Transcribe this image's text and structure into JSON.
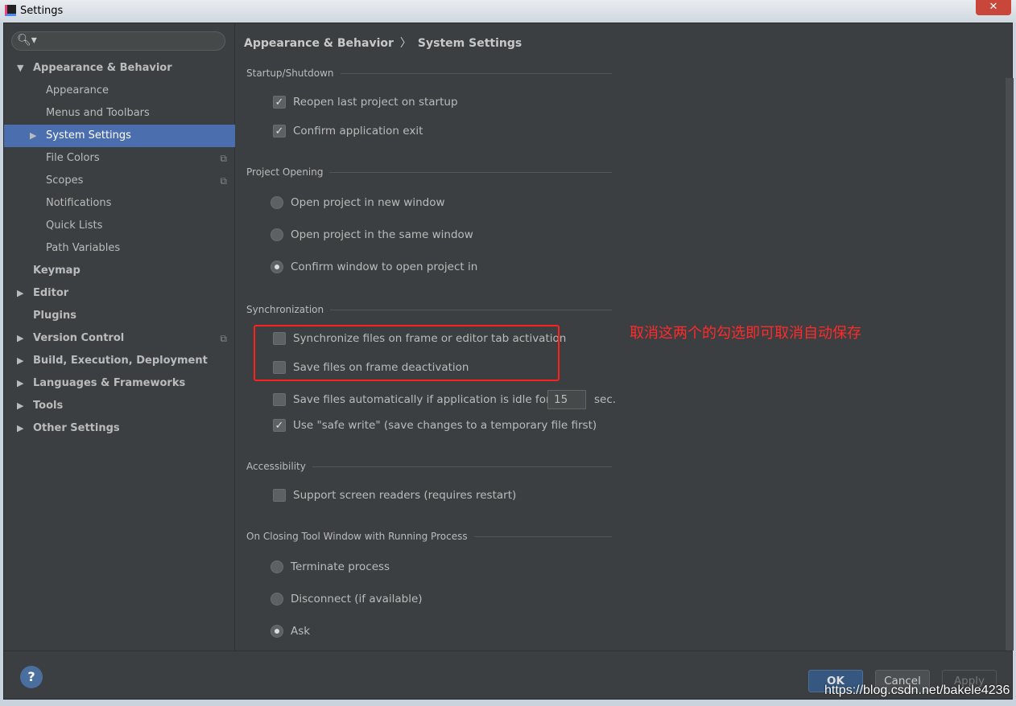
{
  "window": {
    "title": "Settings",
    "close": "✕"
  },
  "search": {
    "icon": "search-icon"
  },
  "tree": [
    {
      "label": "Appearance & Behavior",
      "level": 0,
      "arrow": "▼"
    },
    {
      "label": "Appearance",
      "level": 1
    },
    {
      "label": "Menus and Toolbars",
      "level": 1
    },
    {
      "label": "System Settings",
      "level": 1,
      "arrow": "▶",
      "selected": true
    },
    {
      "label": "File Colors",
      "level": 1,
      "copy": true
    },
    {
      "label": "Scopes",
      "level": 1,
      "copy": true
    },
    {
      "label": "Notifications",
      "level": 1
    },
    {
      "label": "Quick Lists",
      "level": 1
    },
    {
      "label": "Path Variables",
      "level": 1
    },
    {
      "label": "Keymap",
      "level": 0
    },
    {
      "label": "Editor",
      "level": 0,
      "arrow": "▶"
    },
    {
      "label": "Plugins",
      "level": 0
    },
    {
      "label": "Version Control",
      "level": 0,
      "arrow": "▶",
      "copy": true
    },
    {
      "label": "Build, Execution, Deployment",
      "level": 0,
      "arrow": "▶"
    },
    {
      "label": "Languages & Frameworks",
      "level": 0,
      "arrow": "▶"
    },
    {
      "label": "Tools",
      "level": 0,
      "arrow": "▶"
    },
    {
      "label": "Other Settings",
      "level": 0,
      "arrow": "▶"
    }
  ],
  "breadcrumb": {
    "parent": "Appearance & Behavior",
    "sep": "〉",
    "current": "System Settings"
  },
  "sections": {
    "startup": "Startup/Shutdown",
    "project": "Project Opening",
    "sync": "Synchronization",
    "access": "Accessibility",
    "closing": "On Closing Tool Window with Running Process"
  },
  "options": {
    "reopen": {
      "label": "Reopen last project on startup",
      "checked": true
    },
    "confirm_exit": {
      "label": "Confirm application exit",
      "checked": true
    },
    "new_window": {
      "label": "Open project in new window",
      "selected": false
    },
    "same_window": {
      "label": "Open project in the same window",
      "selected": false
    },
    "confirm_window": {
      "label": "Confirm window to open project in",
      "selected": true
    },
    "sync_files": {
      "label": "Synchronize files on frame or editor tab activation",
      "checked": false
    },
    "save_deact": {
      "label": "Save files on frame deactivation",
      "checked": false
    },
    "save_idle": {
      "label": "Save files automatically if application is idle for",
      "checked": false,
      "value": "15",
      "unit": "sec."
    },
    "safe_write": {
      "label": "Use \"safe write\" (save changes to a temporary file first)",
      "checked": true
    },
    "screen_readers": {
      "label": "Support screen readers (requires restart)",
      "checked": false
    },
    "terminate": {
      "label": "Terminate process",
      "selected": false
    },
    "disconnect": {
      "label": "Disconnect (if available)",
      "selected": false
    },
    "ask": {
      "label": "Ask",
      "selected": true
    }
  },
  "annotation": "取消这两个的勾选即可取消自动保存",
  "annotation_color": "#ff2a2a",
  "footer": {
    "help": "?",
    "ok": "OK",
    "cancel": "Cancel",
    "apply": "Apply"
  },
  "watermark": "https://blog.csdn.net/bakele4236"
}
